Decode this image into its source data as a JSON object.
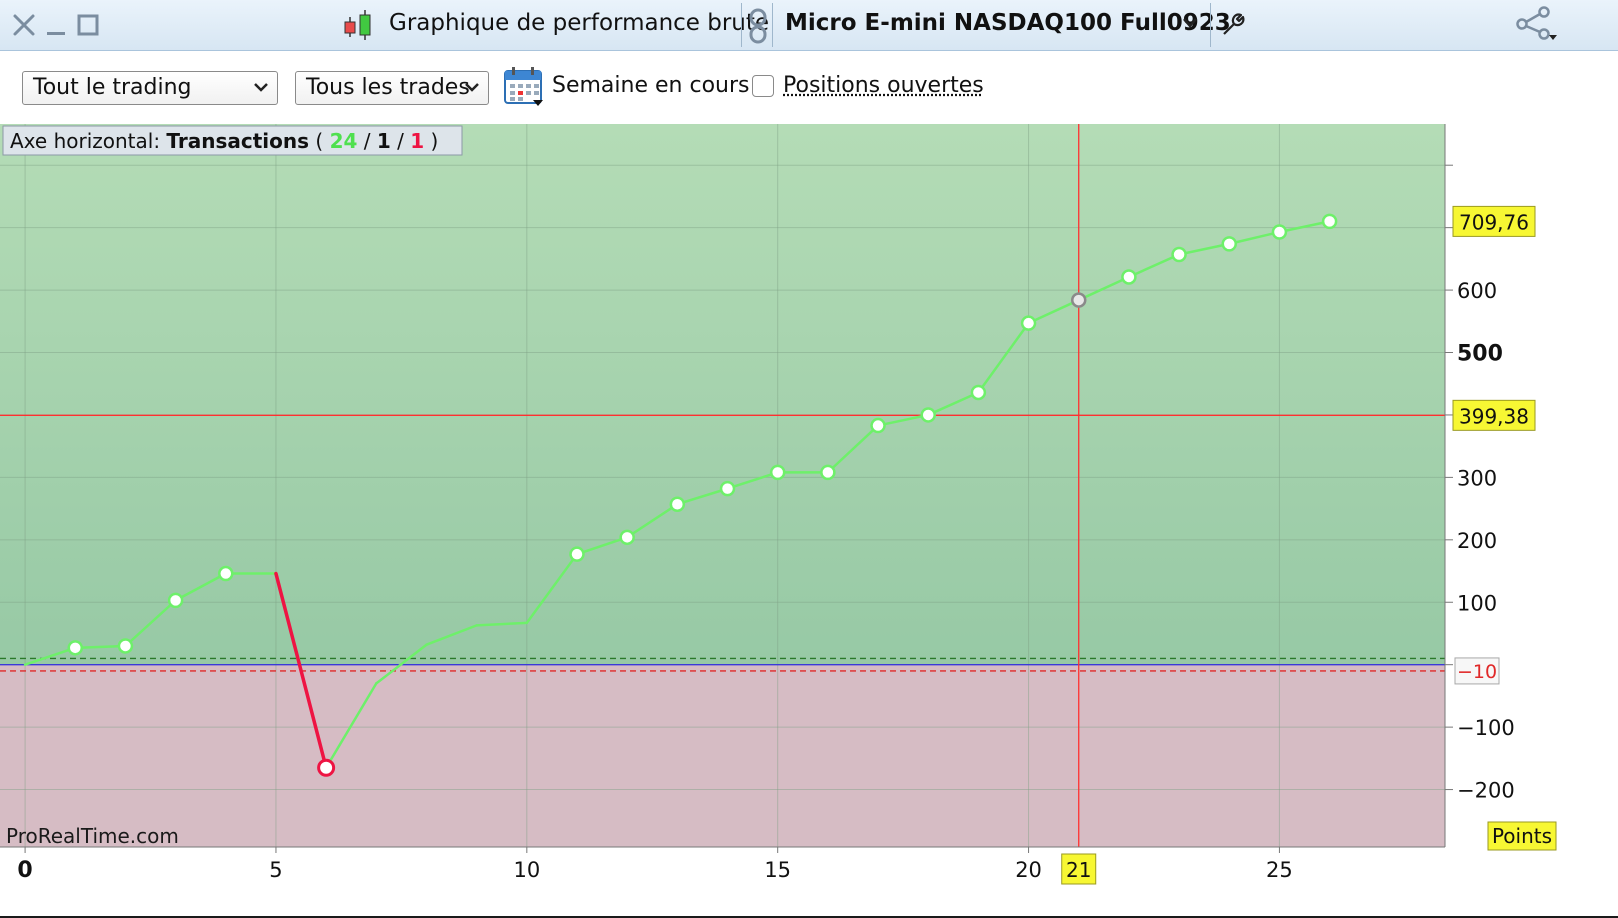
{
  "window": {
    "title": "Graphique de performance brute",
    "instrument": "Micro E-mini NASDAQ100 Full0923"
  },
  "toolbar": {
    "scope_select": "Tout le trading",
    "trades_select": "Tous les trades",
    "period_label": "Semaine en cours",
    "open_positions_label": "Positions ouvertes",
    "open_positions_checked": false
  },
  "axis_info": {
    "prefix": "Axe horizontal:",
    "name": "Transactions",
    "open_paren": "(",
    "winning": "24",
    "sep1": "/",
    "neutral": "1",
    "sep2": "/",
    "losing": "1",
    "close_paren": ")"
  },
  "watermark": "ProRealTime.com",
  "units_badge": "Points",
  "colors": {
    "positive_line": "#6ef06a",
    "negative_line": "#ee1443",
    "positive_zone": "#a8d5ae",
    "negative_zone": "#d6bcc4",
    "crosshair": "#ff3030",
    "badge_fill": "#f7f733"
  },
  "chart_data": {
    "type": "line",
    "xlabel": "",
    "ylabel": "",
    "xlim": [
      -0.5,
      28.3
    ],
    "ylim": [
      -292,
      866
    ],
    "xticks": [
      "0",
      "5",
      "10",
      "15",
      "20",
      "25"
    ],
    "xtick_values": [
      0,
      5,
      10,
      15,
      20,
      25
    ],
    "yticks": [
      "600",
      "500",
      "300",
      "200",
      "100",
      "−100",
      "−200"
    ],
    "ytick_values": [
      600,
      500,
      300,
      200,
      100,
      -100,
      -200
    ],
    "series": [
      {
        "x": [
          0,
          1,
          2,
          3,
          4,
          5,
          6,
          7,
          8,
          9,
          10,
          11,
          12,
          13,
          14,
          15,
          16,
          17,
          18,
          19,
          20,
          21,
          22,
          23,
          24,
          25,
          26
        ],
        "y": [
          0,
          27,
          30,
          103,
          146,
          146,
          -165,
          -30,
          32,
          63,
          67,
          177,
          204,
          257,
          282,
          308,
          308,
          383,
          400,
          436,
          547,
          584,
          621,
          657,
          674,
          693,
          710
        ]
      }
    ],
    "losing_segment": [
      5,
      6
    ],
    "markers_omitted_at": [
      0,
      5,
      7,
      8,
      9,
      10
    ],
    "highlighted_point": 21,
    "reference_lines": {
      "green_dashed": 10,
      "blue": 0,
      "red_dashed": -10
    },
    "crosshair": {
      "x": 21,
      "y": 399.38
    },
    "badges": {
      "max_value": "709,76",
      "crosshair_value": "399,38",
      "crosshair_x": "21",
      "min_value": "−10"
    }
  }
}
